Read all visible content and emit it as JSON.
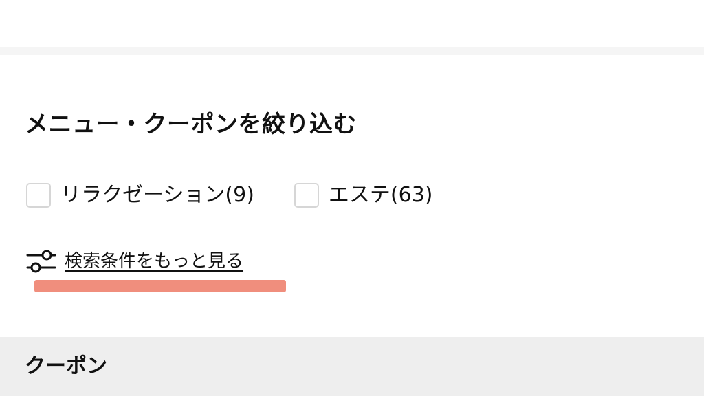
{
  "filter_section": {
    "title": "メニュー・クーポンを絞り込む",
    "options": [
      {
        "label": "リラクゼーション(9)",
        "checked": false
      },
      {
        "label": "エステ(63)",
        "checked": false
      }
    ],
    "more_link": {
      "label": "検索条件をもっと見る",
      "icon": "sliders-icon"
    },
    "highlight_color": "#ef8876"
  },
  "coupon_section": {
    "title": "クーポン",
    "background": "#eeeeee"
  }
}
